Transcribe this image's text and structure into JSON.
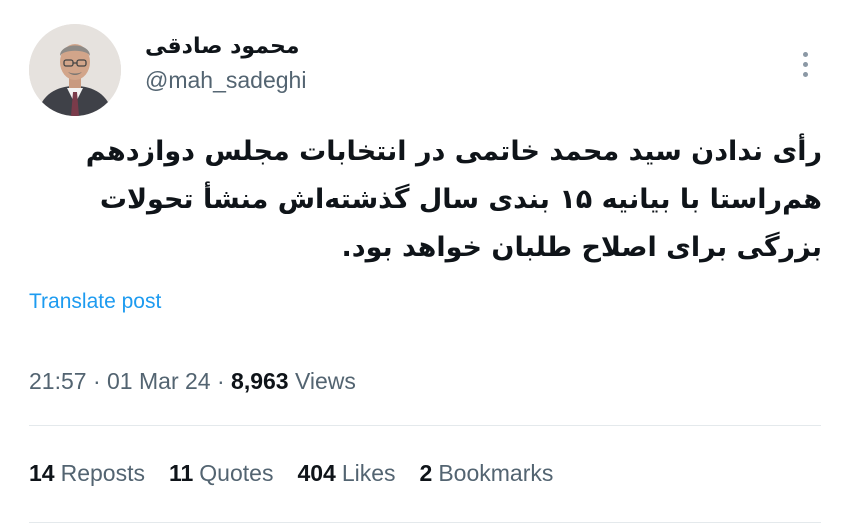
{
  "author": {
    "display_name": "محمود صادقی",
    "handle": "@mah_sadeghi"
  },
  "post": {
    "text": "رأی ندادن سید محمد خاتمی در انتخابات مجلس دوازدهم هم‌راستا با بیانیه ۱۵ بندی سال گذشته‌اش منشأ تحولات بزرگی برای اصلاح طلبان خواهد بود.",
    "translate_label": "Translate post"
  },
  "meta": {
    "time": "21:57",
    "date": "01 Mar 24",
    "separator": "·",
    "views_count": "8,963",
    "views_label": "Views"
  },
  "stats": {
    "reposts_count": "14",
    "reposts_label": "Reposts",
    "quotes_count": "11",
    "quotes_label": "Quotes",
    "likes_count": "404",
    "likes_label": "Likes",
    "bookmarks_count": "2",
    "bookmarks_label": "Bookmarks"
  },
  "icons": {
    "more": "more-vertical-icon"
  },
  "colors": {
    "text": "#0f1419",
    "secondary": "#536471",
    "link": "#1d9bf0",
    "divider": "#e4e9ec"
  }
}
